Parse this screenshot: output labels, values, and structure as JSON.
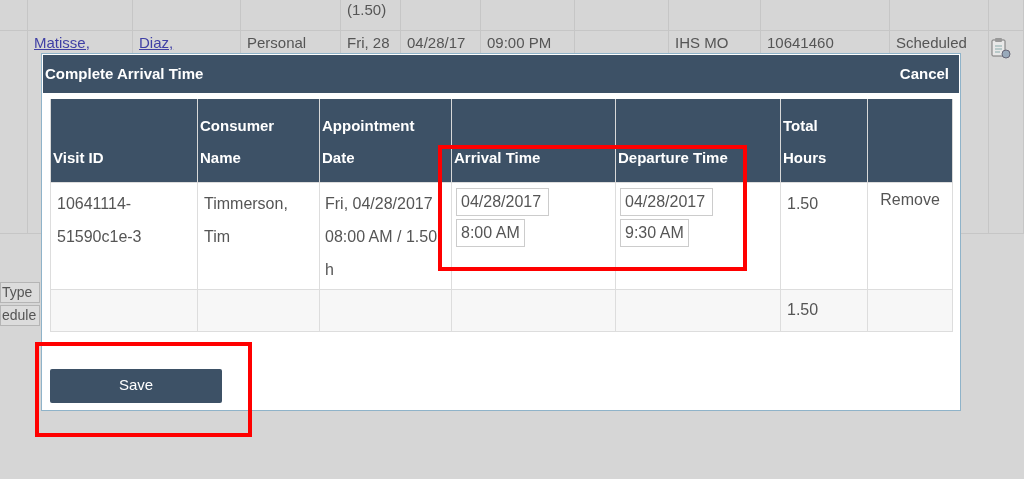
{
  "background_table": {
    "rows": [
      {
        "cells": [
          "",
          "",
          "",
          "",
          "(1.50)",
          "",
          "",
          "",
          "",
          "",
          ""
        ]
      },
      {
        "cells": [
          "",
          "Matisse,",
          "Diaz,",
          "Personal",
          "Fri, 28",
          "04/28/17",
          "09:00 PM",
          "",
          "IHS MO",
          "10641460",
          "Scheduled"
        ]
      }
    ]
  },
  "side_buttons": [
    "Type",
    "edule"
  ],
  "dialog": {
    "title": "Complete Arrival Time",
    "cancel": "Cancel",
    "columns": [
      "Visit ID",
      "Consumer Name",
      "Appointment Date",
      "Arrival Time",
      "Departure Time",
      "Total Hours",
      ""
    ],
    "rows": [
      {
        "visit_id": "10641114-51590c1e-3",
        "consumer": "Timmerson, Tim",
        "appointment": "Fri, 04/28/2017 08:00 AM / 1.50 h",
        "arrival_date": "04/28/2017",
        "arrival_time": "8:00 AM",
        "departure_date": "04/28/2017",
        "departure_time": "9:30 AM",
        "total_hours": "1.50",
        "action": "Remove"
      }
    ],
    "footer": {
      "total_hours": "1.50"
    },
    "save": "Save"
  }
}
